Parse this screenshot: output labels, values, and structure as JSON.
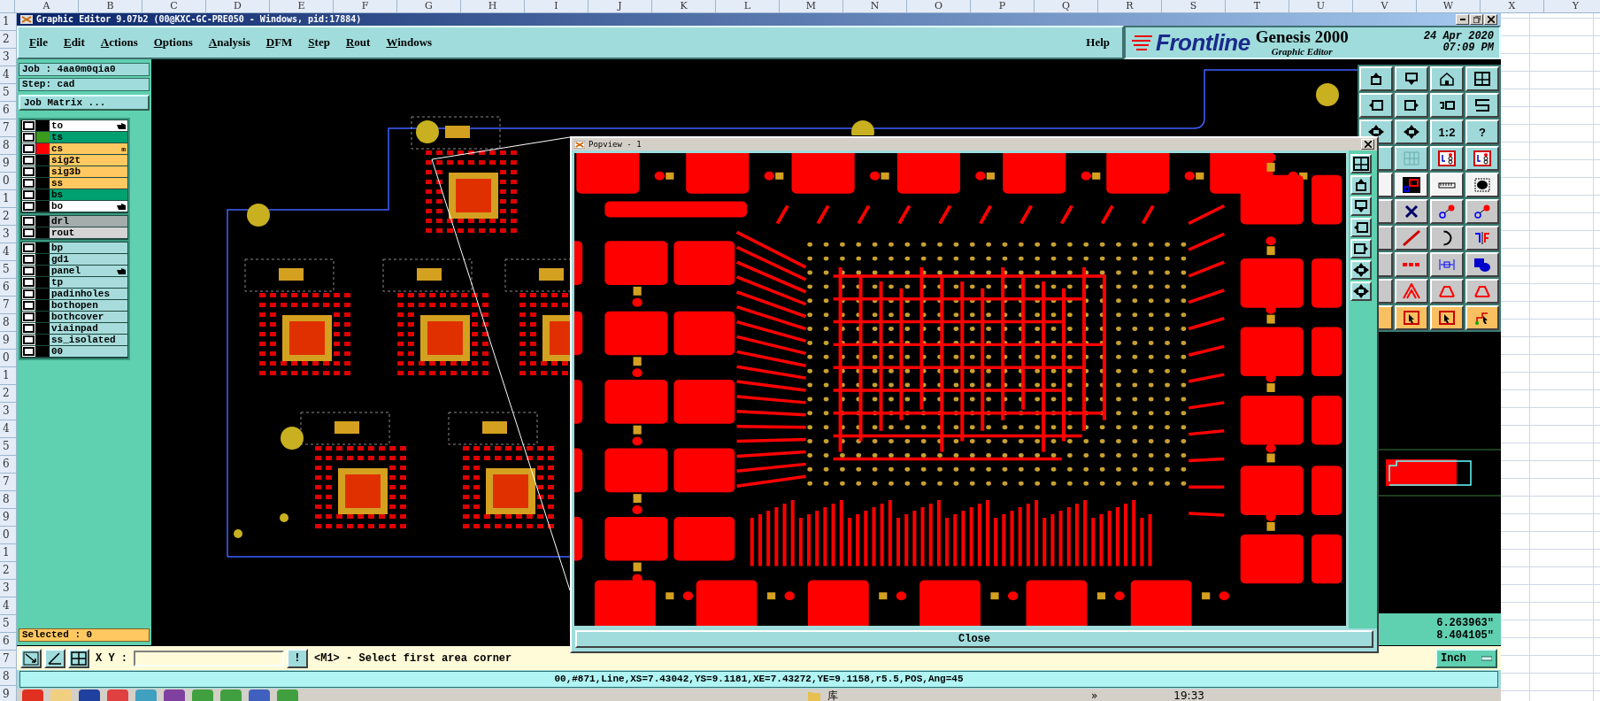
{
  "excel": {
    "columns": [
      "A",
      "B",
      "C",
      "D",
      "E",
      "F",
      "G",
      "H",
      "I",
      "J",
      "K",
      "L",
      "M",
      "N",
      "O",
      "P",
      "Q",
      "R",
      "S",
      "T",
      "U",
      "V",
      "W",
      "X",
      "Y"
    ],
    "rows": [
      "1",
      "2",
      "3",
      "4",
      "5",
      "6",
      "7",
      "8",
      "9",
      "0",
      "1",
      "2",
      "3",
      "4",
      "5",
      "6",
      "7",
      "8",
      "9",
      "0",
      "1",
      "2",
      "3",
      "4",
      "5",
      "6",
      "7",
      "8",
      "9",
      "0",
      "1",
      "2",
      "3",
      "4",
      "5",
      "6",
      "7",
      "8",
      "9"
    ]
  },
  "window": {
    "title": "Graphic Editor 9.07b2 (00@KXC-GC-PRE050 - Windows, pid:17884)"
  },
  "menu": [
    "File",
    "Edit",
    "Actions",
    "Options",
    "Analysis",
    "DFM",
    "Step",
    "Rout",
    "Windows"
  ],
  "help": "Help",
  "brand": {
    "logo": "Frontline",
    "product": "Genesis 2000",
    "subtitle": "Graphic Editor",
    "date": "24 Apr 2020",
    "time": "07:09 PM"
  },
  "job": {
    "job": "Job : 4aa0m0qia0",
    "step": "Step: cad",
    "matrix_button": "Job Matrix ..."
  },
  "layer_groups": [
    {
      "layers": [
        {
          "name": "to",
          "kind": "silk",
          "active": false,
          "hand": true
        },
        {
          "name": "ts",
          "kind": "mask",
          "active": false,
          "hand": false,
          "color": "#3c9a1e"
        },
        {
          "name": "cs",
          "kind": "signal",
          "active": true,
          "hand": false,
          "color": "#ff0000",
          "flag": "m"
        },
        {
          "name": "sig2t",
          "kind": "signal",
          "active": false,
          "hand": false
        },
        {
          "name": "sig3b",
          "kind": "signal",
          "active": false,
          "hand": false
        },
        {
          "name": "ss",
          "kind": "signal",
          "active": false,
          "hand": false
        },
        {
          "name": "bs",
          "kind": "mask",
          "active": false,
          "hand": false
        },
        {
          "name": "bo",
          "kind": "silk",
          "active": false,
          "hand": true
        }
      ]
    },
    {
      "layers": [
        {
          "name": "drl",
          "kind": "drill",
          "active": false,
          "hand": false
        },
        {
          "name": "rout",
          "kind": "rout",
          "active": false,
          "hand": false
        }
      ]
    },
    {
      "layers": [
        {
          "name": "bp",
          "kind": "document",
          "active": false,
          "hand": false
        },
        {
          "name": "gd1",
          "kind": "document",
          "active": false,
          "hand": false
        },
        {
          "name": "panel",
          "kind": "document",
          "active": false,
          "hand": true
        },
        {
          "name": "tp",
          "kind": "document",
          "active": false,
          "hand": false
        },
        {
          "name": "padinholes",
          "kind": "document",
          "active": false,
          "hand": false
        },
        {
          "name": "bothopen",
          "kind": "document",
          "active": false,
          "hand": false
        },
        {
          "name": "bothcover",
          "kind": "document",
          "active": false,
          "hand": false
        },
        {
          "name": "viainpad",
          "kind": "document",
          "active": false,
          "hand": false
        },
        {
          "name": "ss_isolated",
          "kind": "document",
          "active": false,
          "hand": false
        },
        {
          "name": "00",
          "kind": "document",
          "active": false,
          "hand": false
        }
      ]
    }
  ],
  "selected": "Selected : 0",
  "right_toolbar": {
    "ratio_button": "1:2",
    "help_button": "?"
  },
  "readout": [
    "6.263963\"",
    "8.404105\""
  ],
  "popview": {
    "title": "Popview - 1",
    "close_button": "Close"
  },
  "bottom_bar": {
    "xy_label": "X Y :",
    "bang_button": "!",
    "prompt": "<M1> - Select first area corner",
    "units": "Inch"
  },
  "status": "00,#871,Line,XS=7.43042,YS=9.1181,XE=7.43272,YE=9.1158,r5.5,POS,Ang=45",
  "taskbar": {
    "folder": "库",
    "more": "»",
    "clock": "19:33"
  }
}
